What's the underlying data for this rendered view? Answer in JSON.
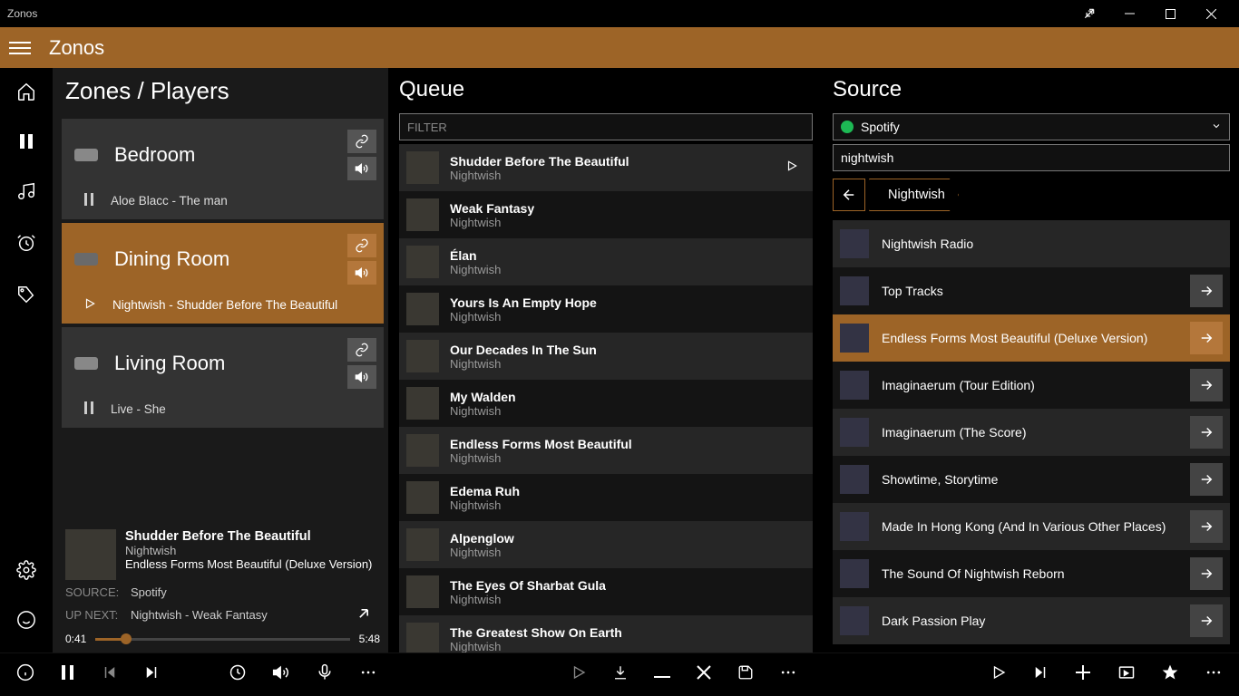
{
  "window": {
    "title": "Zonos"
  },
  "header": {
    "app_name": "Zonos"
  },
  "zones": {
    "heading": "Zones / Players",
    "list": [
      {
        "name": "Bedroom",
        "now": "Aloe Blacc - The man",
        "state": "paused"
      },
      {
        "name": "Dining Room",
        "now": "Nightwish - Shudder Before The Beautiful",
        "state": "playing"
      },
      {
        "name": "Living Room",
        "now": "Live - She",
        "state": "paused"
      }
    ]
  },
  "nowplaying": {
    "title": "Shudder Before The Beautiful",
    "artist": "Nightwish",
    "album": "Endless Forms Most Beautiful (Deluxe Version)",
    "source_label": "SOURCE:",
    "source_value": "Spotify",
    "upnext_label": "UP NEXT:",
    "upnext_value": "Nightwish - Weak Fantasy",
    "elapsed": "0:41",
    "total": "5:48",
    "progress_pct": 12
  },
  "queue": {
    "heading": "Queue",
    "filter_placeholder": "FILTER",
    "tracks": [
      {
        "title": "Shudder Before The Beautiful",
        "artist": "Nightwish",
        "current": true
      },
      {
        "title": "Weak Fantasy",
        "artist": "Nightwish"
      },
      {
        "title": "Élan",
        "artist": "Nightwish"
      },
      {
        "title": "Yours Is An Empty Hope",
        "artist": "Nightwish"
      },
      {
        "title": "Our Decades In The Sun",
        "artist": "Nightwish"
      },
      {
        "title": "My Walden",
        "artist": "Nightwish"
      },
      {
        "title": "Endless Forms Most Beautiful",
        "artist": "Nightwish"
      },
      {
        "title": "Edema Ruh",
        "artist": "Nightwish"
      },
      {
        "title": "Alpenglow",
        "artist": "Nightwish"
      },
      {
        "title": "The Eyes Of Sharbat Gula",
        "artist": "Nightwish"
      },
      {
        "title": "The Greatest Show On Earth",
        "artist": "Nightwish"
      }
    ]
  },
  "source": {
    "heading": "Source",
    "provider": "Spotify",
    "search": "nightwish",
    "breadcrumb": "Nightwish",
    "items": [
      {
        "name": "Nightwish Radio",
        "arrow": false
      },
      {
        "name": "Top Tracks",
        "arrow": true
      },
      {
        "name": "Endless Forms Most Beautiful (Deluxe Version)",
        "arrow": true,
        "selected": true
      },
      {
        "name": "Imaginaerum (Tour Edition)",
        "arrow": true
      },
      {
        "name": "Imaginaerum (The Score)",
        "arrow": true
      },
      {
        "name": "Showtime, Storytime",
        "arrow": true
      },
      {
        "name": "Made In Hong Kong (And In Various Other Places)",
        "arrow": true
      },
      {
        "name": "The Sound Of Nightwish Reborn",
        "arrow": true
      },
      {
        "name": "Dark Passion Play",
        "arrow": true
      }
    ]
  }
}
